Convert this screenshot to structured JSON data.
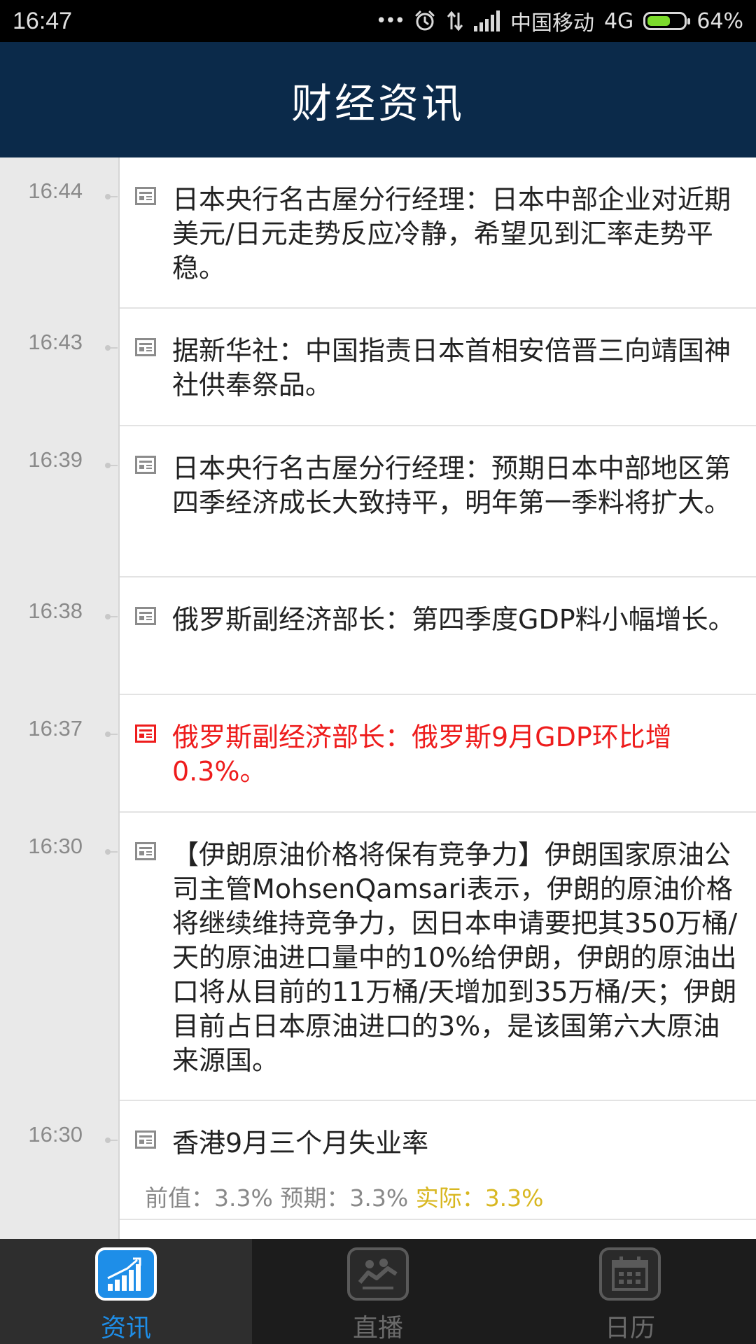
{
  "status_bar": {
    "time": "16:47",
    "dots": "•••",
    "carrier": "中国移动",
    "network": "4G",
    "battery": "64%",
    "battery_level": 0.64,
    "icons": [
      "alarm-icon",
      "data-arrows-icon",
      "signal-icon",
      "battery-icon"
    ]
  },
  "header": {
    "title": "财经资讯",
    "background": "#0b2a4a"
  },
  "news": [
    {
      "time": "16:44",
      "text": "日本央行名古屋分行经理：日本中部企业对近期美元/日元走势反应冷静，希望见到汇率走势平稳。",
      "highlight": false
    },
    {
      "time": "16:43",
      "text": "据新华社：中国指责日本首相安倍晋三向靖国神社供奉祭品。",
      "highlight": false
    },
    {
      "time": "16:39",
      "text": "日本央行名古屋分行经理：预期日本中部地区第四季经济成长大致持平，明年第一季料将扩大。",
      "highlight": false
    },
    {
      "time": "16:38",
      "text": "俄罗斯副经济部长：第四季度GDP料小幅增长。",
      "highlight": false
    },
    {
      "time": "16:37",
      "text": "俄罗斯副经济部长：俄罗斯9月GDP环比增0.3%。",
      "highlight": true
    },
    {
      "time": "16:30",
      "text": "【伊朗原油价格将保有竞争力】伊朗国家原油公司主管MohsenQamsari表示，伊朗的原油价格将继续维持竞争力，因日本申请要把其350万桶/天的原油进口量中的10%给伊朗，伊朗的原油出口将从目前的11万桶/天增加到35万桶/天；伊朗目前占日本原油进口的3%，是该国第六大原油来源国。",
      "highlight": false
    },
    {
      "time": "16:30",
      "text": "香港9月三个月失业率",
      "highlight": false,
      "stats": {
        "previous": "前值：3.3%",
        "forecast": "预期：3.3%",
        "actual": "实际：3.3%"
      }
    }
  ],
  "colors": {
    "highlight": "#ee1c1c",
    "actual": "#d8b720",
    "accent": "#1e8ee8"
  },
  "nav": {
    "tabs": [
      {
        "label": "资讯",
        "icon": "chart-growth-icon",
        "active": true
      },
      {
        "label": "直播",
        "icon": "live-handshake-icon",
        "active": false
      },
      {
        "label": "日历",
        "icon": "calendar-icon",
        "active": false
      }
    ]
  }
}
